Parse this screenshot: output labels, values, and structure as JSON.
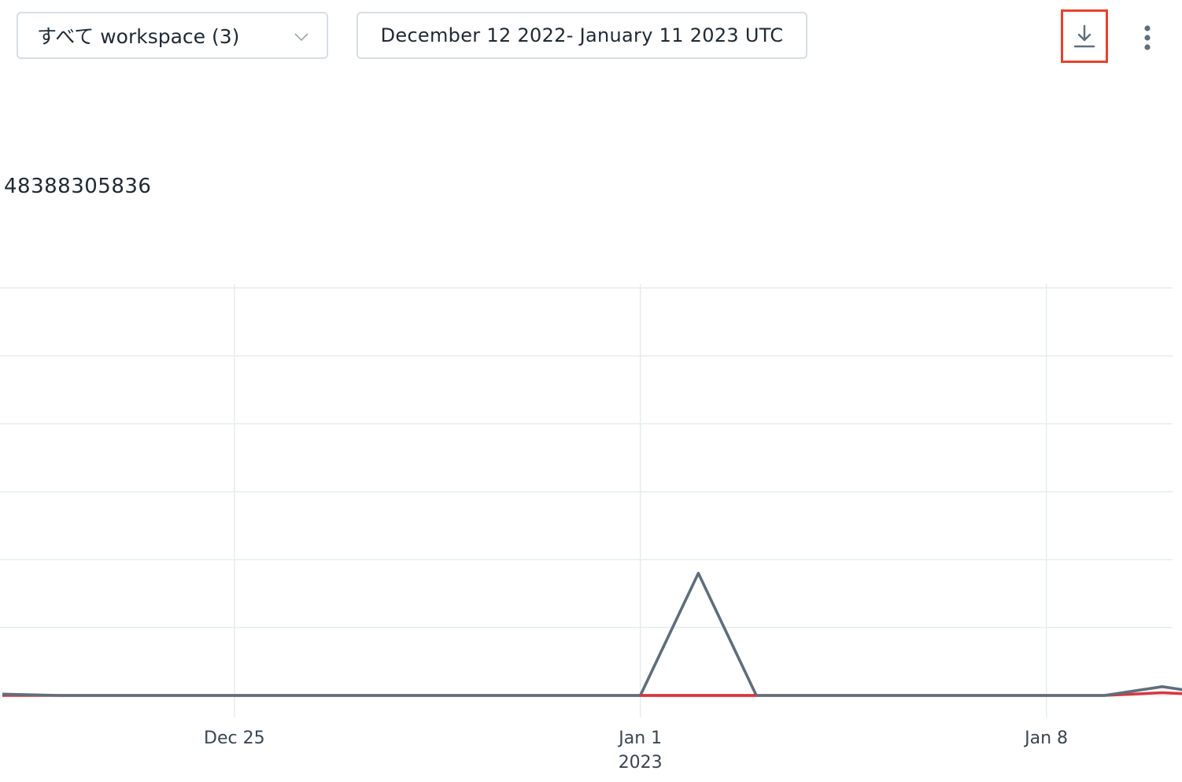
{
  "toolbar": {
    "workspace_select": "すべて workspace (3)",
    "date_range": "December 12 2022- January 11 2023 UTC",
    "download_icon": "download-icon",
    "more_icon": "more-vertical-icon"
  },
  "summary": {
    "value": "48388305836"
  },
  "colors": {
    "series_gray": "#5f6e7c",
    "series_red": "#d9363e",
    "grid": "#e6ecef",
    "highlight": "#e8412c"
  },
  "chart_data": {
    "type": "line",
    "x_tick_labels": [
      {
        "date": "2022-12-25",
        "label": "Dec 25",
        "sublabel": ""
      },
      {
        "date": "2023-01-01",
        "label": "Jan 1",
        "sublabel": "2023"
      },
      {
        "date": "2023-01-08",
        "label": "Jan 8",
        "sublabel": ""
      }
    ],
    "xlim": [
      "2022-12-21",
      "2023-01-11"
    ],
    "grid": true,
    "gridlines_y": 7,
    "series": [
      {
        "color": "#5f6e7c",
        "points": [
          [
            "2022-12-21",
            0.02
          ],
          [
            "2022-12-22",
            0
          ],
          [
            "2022-12-23",
            0
          ],
          [
            "2022-12-24",
            0
          ],
          [
            "2022-12-25",
            0
          ],
          [
            "2022-12-26",
            0
          ],
          [
            "2022-12-27",
            0
          ],
          [
            "2022-12-28",
            0
          ],
          [
            "2022-12-29",
            0
          ],
          [
            "2022-12-30",
            0
          ],
          [
            "2022-12-31",
            0
          ],
          [
            "2023-01-01",
            0
          ],
          [
            "2023-01-02",
            1.8
          ],
          [
            "2023-01-03",
            0
          ],
          [
            "2023-01-04",
            0
          ],
          [
            "2023-01-05",
            0
          ],
          [
            "2023-01-06",
            0
          ],
          [
            "2023-01-07",
            0
          ],
          [
            "2023-01-08",
            0
          ],
          [
            "2023-01-09",
            0
          ],
          [
            "2023-01-10",
            0.13
          ],
          [
            "2023-01-11",
            0
          ]
        ]
      },
      {
        "color": "#d9363e",
        "points": [
          [
            "2022-12-21",
            0
          ],
          [
            "2022-12-22",
            0
          ],
          [
            "2022-12-23",
            0
          ],
          [
            "2022-12-24",
            0
          ],
          [
            "2022-12-25",
            0
          ],
          [
            "2022-12-26",
            0
          ],
          [
            "2022-12-27",
            0
          ],
          [
            "2022-12-28",
            0
          ],
          [
            "2022-12-29",
            0
          ],
          [
            "2022-12-30",
            0
          ],
          [
            "2022-12-31",
            0
          ],
          [
            "2023-01-01",
            0
          ],
          [
            "2023-01-02",
            0
          ],
          [
            "2023-01-03",
            0
          ],
          [
            "2023-01-04",
            0
          ],
          [
            "2023-01-05",
            0
          ],
          [
            "2023-01-06",
            0
          ],
          [
            "2023-01-07",
            0
          ],
          [
            "2023-01-08",
            0
          ],
          [
            "2023-01-09",
            0
          ],
          [
            "2023-01-10",
            0.04
          ],
          [
            "2023-01-11",
            0
          ]
        ]
      }
    ]
  }
}
